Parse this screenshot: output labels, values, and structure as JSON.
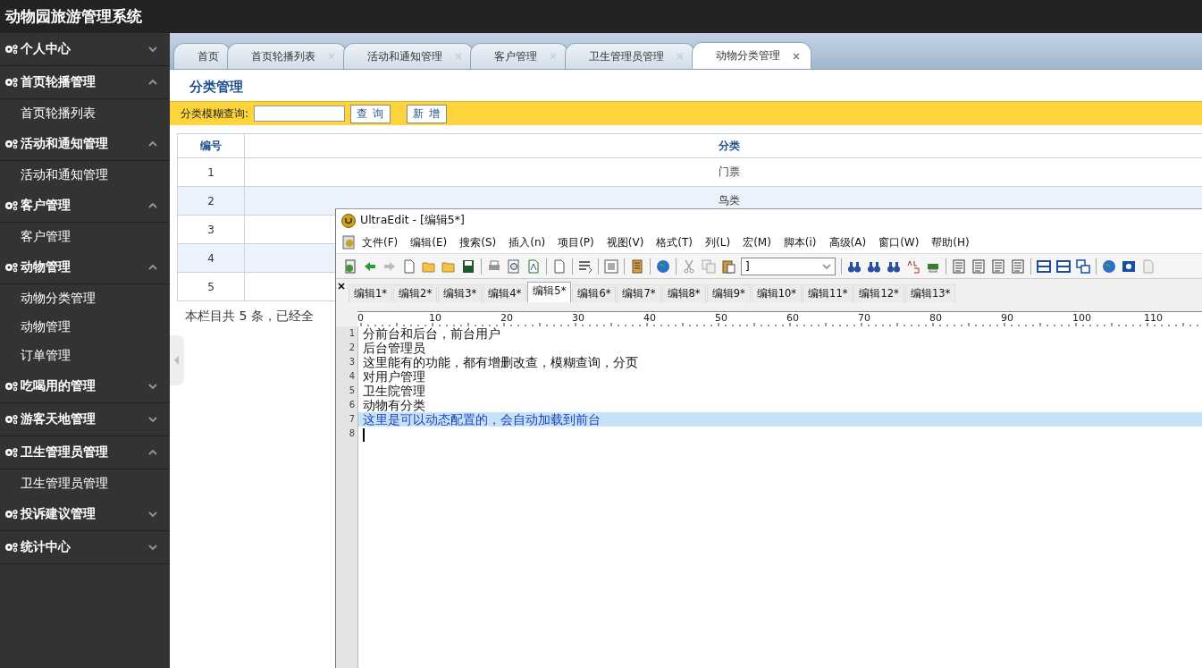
{
  "header": {
    "title": "动物园旅游管理系统"
  },
  "sidebar": {
    "groups": [
      {
        "label": "个人中心",
        "expanded": false
      },
      {
        "label": "首页轮播管理",
        "expanded": true,
        "children": [
          {
            "label": "首页轮播列表"
          }
        ]
      },
      {
        "label": "活动和通知管理",
        "expanded": true,
        "children": [
          {
            "label": "活动和通知管理"
          }
        ]
      },
      {
        "label": "客户管理",
        "expanded": true,
        "children": [
          {
            "label": "客户管理"
          }
        ]
      },
      {
        "label": "动物管理",
        "expanded": true,
        "children": [
          {
            "label": "动物分类管理"
          },
          {
            "label": "动物管理"
          },
          {
            "label": "订单管理"
          }
        ]
      },
      {
        "label": "吃喝用的管理",
        "expanded": false
      },
      {
        "label": "游客天地管理",
        "expanded": false
      },
      {
        "label": "卫生管理员管理",
        "expanded": true,
        "children": [
          {
            "label": "卫生管理员管理"
          }
        ]
      },
      {
        "label": "投诉建议管理",
        "expanded": false
      },
      {
        "label": "统计中心",
        "expanded": false
      }
    ]
  },
  "tabs": [
    {
      "label": "首页",
      "selected": false,
      "closable": false
    },
    {
      "label": "首页轮播列表",
      "selected": false,
      "closable": true
    },
    {
      "label": "活动和通知管理",
      "selected": false,
      "closable": true
    },
    {
      "label": "客户管理",
      "selected": false,
      "closable": true
    },
    {
      "label": "卫生管理员管理",
      "selected": false,
      "closable": true
    },
    {
      "label": "动物分类管理",
      "selected": true,
      "closable": true
    }
  ],
  "page": {
    "heading": "分类管理",
    "search_label": "分类模糊查询:",
    "search_button": "查 询",
    "add_button": "新 增",
    "table": {
      "columns": [
        "编号",
        "分类"
      ],
      "rows": [
        [
          "1",
          "门票"
        ],
        [
          "2",
          "鸟类"
        ],
        [
          "3"
        ],
        [
          "4"
        ],
        [
          "5"
        ]
      ]
    },
    "footer": "本栏目共 5 条，已经全"
  },
  "editor": {
    "title": "UltraEdit - [编辑5*]",
    "menu": [
      "文件(F)",
      "编辑(E)",
      "搜索(S)",
      "插入(n)",
      "项目(P)",
      "视图(V)",
      "格式(T)",
      "列(L)",
      "宏(M)",
      "脚本(i)",
      "高级(A)",
      "窗口(W)",
      "帮助(H)"
    ],
    "dropdown_value": "]",
    "tabs": [
      {
        "label": "编辑1*",
        "selected": false
      },
      {
        "label": "编辑2*",
        "selected": false
      },
      {
        "label": "编辑3*",
        "selected": false
      },
      {
        "label": "编辑4*",
        "selected": false
      },
      {
        "label": "编辑5*",
        "selected": true
      },
      {
        "label": "编辑6*",
        "selected": false
      },
      {
        "label": "编辑7*",
        "selected": false
      },
      {
        "label": "编辑8*",
        "selected": false
      },
      {
        "label": "编辑9*",
        "selected": false
      },
      {
        "label": "编辑10*",
        "selected": false
      },
      {
        "label": "编辑11*",
        "selected": false
      },
      {
        "label": "编辑12*",
        "selected": false
      },
      {
        "label": "编辑13*",
        "selected": false
      }
    ],
    "ruler": [
      "0",
      "10",
      "20",
      "30",
      "40",
      "50",
      "60",
      "70",
      "80",
      "90",
      "100",
      "110"
    ],
    "lines": [
      {
        "number": "1",
        "text": "分前台和后台，前台用户",
        "selected": false,
        "cursor": false
      },
      {
        "number": "2",
        "text": "后台管理员",
        "selected": false,
        "cursor": false
      },
      {
        "number": "3",
        "text": "这里能有的功能，都有增删改查，模糊查询，分页",
        "selected": false,
        "cursor": false
      },
      {
        "number": "4",
        "text": "对用户管理",
        "selected": false,
        "cursor": false
      },
      {
        "number": "5",
        "text": "卫生院管理",
        "selected": false,
        "cursor": false
      },
      {
        "number": "6",
        "text": "动物有分类",
        "selected": false,
        "cursor": false
      },
      {
        "number": "7",
        "text": "这里是可以动态配置的，会自动加载到前台",
        "selected": true,
        "cursor": false
      },
      {
        "number": "8",
        "selected": false,
        "cursor": true
      }
    ]
  }
}
